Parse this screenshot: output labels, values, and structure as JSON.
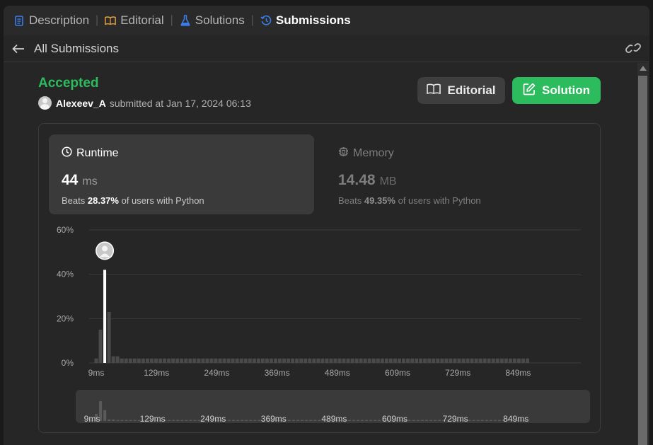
{
  "tabs": [
    {
      "label": "Description",
      "icon": "description-icon",
      "active": false
    },
    {
      "label": "Editorial",
      "icon": "book-icon",
      "active": false
    },
    {
      "label": "Solutions",
      "icon": "flask-icon",
      "active": false
    },
    {
      "label": "Submissions",
      "icon": "history-icon",
      "active": true
    }
  ],
  "subbar": {
    "title": "All Submissions"
  },
  "submission": {
    "status": "Accepted",
    "status_color": "#2cbb5d",
    "user": "Alexeev_A",
    "submitted_text": "submitted at Jan 17, 2024 06:13"
  },
  "buttons": {
    "editorial": "Editorial",
    "solution": "Solution"
  },
  "runtime": {
    "title": "Runtime",
    "value": "44",
    "unit": "ms",
    "beats_prefix": "Beats",
    "beats_pct": "28.37%",
    "beats_suffix": "of users with Python"
  },
  "memory": {
    "title": "Memory",
    "value": "14.48",
    "unit": "MB",
    "beats_prefix": "Beats",
    "beats_pct": "49.35%",
    "beats_suffix": "of users with Python"
  },
  "chart_data": {
    "type": "bar",
    "title": "",
    "xlabel": "",
    "ylabel": "",
    "x_ticks": [
      "9ms",
      "129ms",
      "249ms",
      "369ms",
      "489ms",
      "609ms",
      "729ms",
      "849ms"
    ],
    "y_ticks": [
      "0%",
      "20%",
      "40%",
      "60%"
    ],
    "ylim": [
      0,
      60
    ],
    "grid": true,
    "bucket_ms": 8.5,
    "first_bucket_ms": 9,
    "values": [
      2,
      15,
      42,
      23,
      3,
      3,
      2,
      2,
      2,
      2,
      2,
      2,
      2,
      2,
      2,
      2,
      2,
      2,
      2,
      2,
      2,
      2,
      2,
      2,
      2,
      2,
      2,
      2,
      2,
      2,
      2,
      2,
      2,
      2,
      2,
      2,
      2,
      2,
      2,
      2,
      2,
      2,
      2,
      2,
      2,
      2,
      2,
      2,
      2,
      2,
      2,
      2,
      2,
      2,
      2,
      2,
      2,
      2,
      2,
      2,
      2,
      2,
      2,
      2,
      2,
      2,
      2,
      2,
      2,
      2,
      2,
      2,
      2,
      2,
      2,
      2,
      2,
      2,
      2,
      2,
      2,
      2,
      2,
      2,
      2,
      2,
      2,
      2,
      2,
      2,
      2,
      2,
      2,
      2,
      2,
      2,
      2,
      2,
      2,
      2,
      2,
      2
    ],
    "highlight_index": 2,
    "colors": {
      "bar": "#4a4a4a",
      "highlight": "#ffffff",
      "grid": "#3c3c3c",
      "tick": "#a8a8a8"
    }
  }
}
